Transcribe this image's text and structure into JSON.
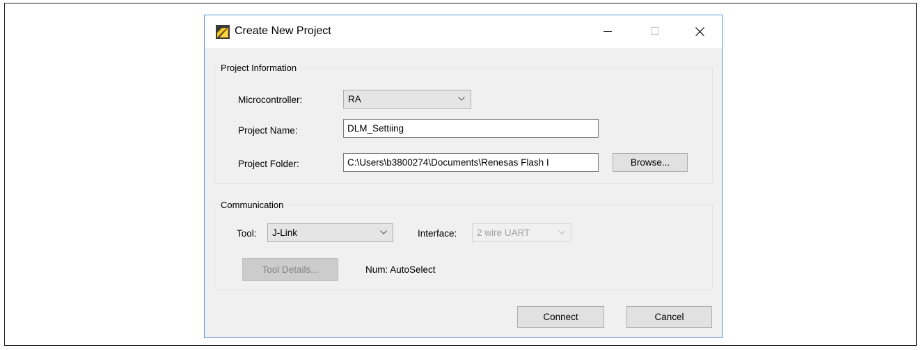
{
  "dialog": {
    "title": "Create New Project",
    "project_info": {
      "legend": "Project Information",
      "microcontroller_label": "Microcontroller:",
      "microcontroller_value": "RA",
      "project_name_label": "Project Name:",
      "project_name_value": "DLM_Settiing",
      "project_folder_label": "Project Folder:",
      "project_folder_value": "C:\\Users\\b3800274\\Documents\\Renesas Flash I",
      "browse_label": "Browse..."
    },
    "communication": {
      "legend": "Communication",
      "tool_label": "Tool:",
      "tool_value": "J-Link",
      "interface_label": "Interface:",
      "interface_value": "2 wire UART",
      "tool_details_label": "Tool Details...",
      "num_text": "Num: AutoSelect"
    },
    "connect_label": "Connect",
    "cancel_label": "Cancel"
  },
  "icons": {
    "app": "renesas-flash-programmer-icon",
    "minimize": "minimize-icon",
    "maximize": "maximize-icon",
    "close": "close-icon",
    "dropdown": "chevron-down-icon"
  },
  "colors": {
    "dialog_bg": "#f0f0f0",
    "titlebar_bg": "#ffffff",
    "window_border": "#5a8fc6",
    "disabled_text": "#a0a0a0"
  }
}
